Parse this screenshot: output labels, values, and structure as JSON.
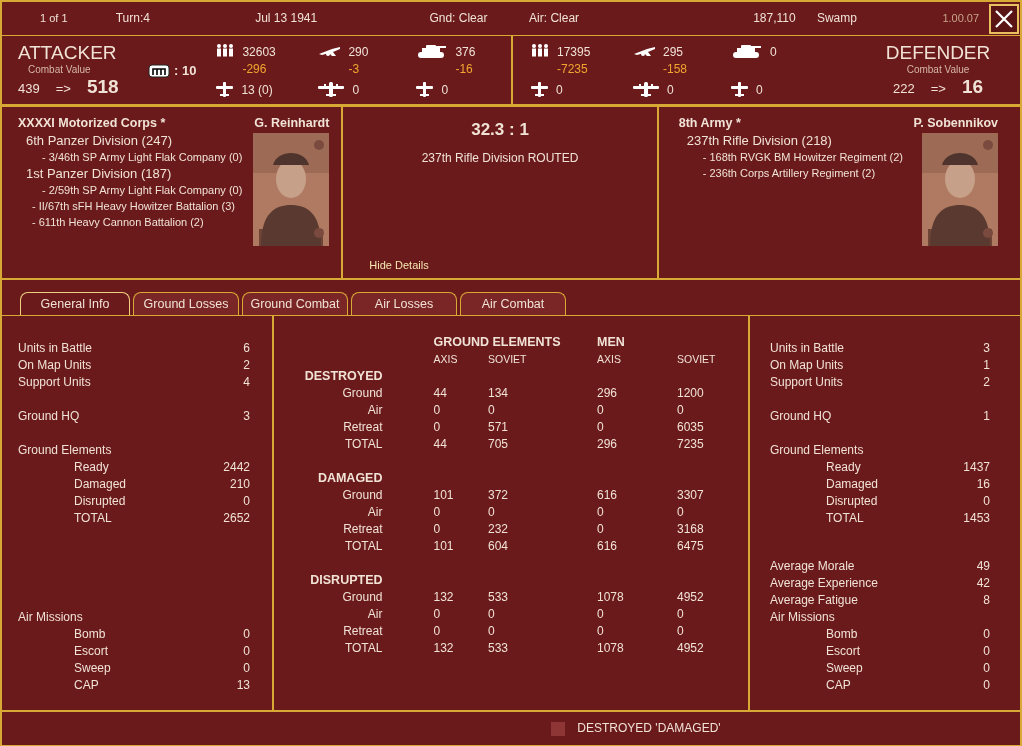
{
  "top_bar": {
    "page": "1 of 1",
    "turn": "Turn:4",
    "date": "Jul 13 1941",
    "ground": "Gnd: Clear",
    "air": "Air: Clear",
    "location": "187,110",
    "terrain": "Swamp",
    "version": "1.00.07"
  },
  "attacker": {
    "title": "ATTACKER",
    "cv_label": "Combat Value",
    "cv_from": "439",
    "arrow": "=>",
    "cv_to": "518",
    "fort": ": 10",
    "stats": [
      {
        "kind": "men",
        "value": "32603",
        "delta": "-296"
      },
      {
        "kind": "gun",
        "value": "290",
        "delta": "-3"
      },
      {
        "kind": "tank",
        "value": "376",
        "delta": "-16"
      },
      {
        "kind": "fighter",
        "value": "13 (0)"
      },
      {
        "kind": "bomber",
        "value": "0"
      },
      {
        "kind": "fighter",
        "value": "0"
      }
    ]
  },
  "defender": {
    "title": "DEFENDER",
    "cv_label": "Combat Value",
    "cv_from": "222",
    "arrow": "=>",
    "cv_to": "16",
    "stats": [
      {
        "kind": "men",
        "value": "17395",
        "delta": "-7235"
      },
      {
        "kind": "gun",
        "value": "295",
        "delta": "-158"
      },
      {
        "kind": "tank",
        "value": "0"
      },
      {
        "kind": "fighter",
        "value": "0"
      },
      {
        "kind": "bomber",
        "value": "0"
      },
      {
        "kind": "fighter",
        "value": "0"
      }
    ]
  },
  "attacker_detail": {
    "hq": "XXXXI Motorized Corps *",
    "leader": "G. Reinhardt",
    "units": [
      {
        "kind": "division",
        "label": "6th Panzer Division (247)",
        "children": [
          {
            "label": "- 3/46th SP Army Light Flak Company (0)"
          }
        ]
      },
      {
        "kind": "division",
        "label": "1st Panzer Division (187)",
        "children": [
          {
            "label": "- 2/59th SP Army Light Flak Company (0)"
          }
        ]
      },
      {
        "kind": "support",
        "label": "- II/67th sFH Heavy Howitzer Battalion (3)"
      },
      {
        "kind": "support",
        "label": "- 611th Heavy Cannon Battalion (2)"
      }
    ]
  },
  "result": {
    "odds": "32.3 : 1",
    "outcome": "237th Rifle Division ROUTED",
    "hide_link": "Hide Details"
  },
  "defender_detail": {
    "hq": "8th Army *",
    "leader": "P. Sobennikov",
    "units": [
      {
        "kind": "division",
        "label": "237th Rifle Division (218)",
        "children": [
          {
            "label": "- 168th RVGK BM Howitzer Regiment (2)"
          },
          {
            "label": "- 236th Corps Artillery Regiment (2)"
          }
        ]
      }
    ]
  },
  "tabs": [
    {
      "label": "General Info",
      "selected": true
    },
    {
      "label": "Ground Losses",
      "selected": false
    },
    {
      "label": "Ground Combat",
      "selected": false
    },
    {
      "label": "Air Losses",
      "selected": false
    },
    {
      "label": "Air Combat",
      "selected": false
    }
  ],
  "attacker_info": [
    [
      {
        "kind": "item",
        "label": "Units in Battle",
        "value": "6"
      },
      {
        "kind": "item",
        "label": "On Map Units",
        "value": "2"
      },
      {
        "kind": "item",
        "label": "Support Units",
        "value": "4"
      }
    ],
    [
      {
        "kind": "item",
        "label": "Ground HQ",
        "value": "3"
      }
    ],
    [
      {
        "kind": "heading",
        "label": "Ground Elements"
      },
      {
        "kind": "sub",
        "label": "Ready",
        "value": "2442"
      },
      {
        "kind": "sub",
        "label": "Damaged",
        "value": "210"
      },
      {
        "kind": "sub",
        "label": "Disrupted",
        "value": "0"
      },
      {
        "kind": "sub",
        "label": "TOTAL",
        "value": "2652"
      }
    ],
    [
      {
        "kind": "heading",
        "label": "Air Missions"
      },
      {
        "kind": "sub",
        "label": "Bomb",
        "value": "0"
      },
      {
        "kind": "sub",
        "label": "Escort",
        "value": "0"
      },
      {
        "kind": "sub",
        "label": "Sweep",
        "value": "0"
      },
      {
        "kind": "sub",
        "label": "CAP",
        "value": "13"
      }
    ]
  ],
  "losses": {
    "groups": [
      "GROUND ELEMENTS",
      "MEN"
    ],
    "columns": [
      "AXIS",
      "SOVIET",
      "AXIS",
      "SOVIET"
    ],
    "sections": [
      {
        "title": "DESTROYED",
        "rows": [
          {
            "label": "Ground",
            "values": [
              "44",
              "134",
              "296",
              "1200"
            ]
          },
          {
            "label": "Air",
            "values": [
              "0",
              "0",
              "0",
              "0"
            ]
          },
          {
            "label": "Retreat",
            "values": [
              "0",
              "571",
              "0",
              "6035"
            ]
          },
          {
            "label": "TOTAL",
            "values": [
              "44",
              "705",
              "296",
              "7235"
            ]
          }
        ]
      },
      {
        "title": "DAMAGED",
        "rows": [
          {
            "label": "Ground",
            "values": [
              "101",
              "372",
              "616",
              "3307"
            ]
          },
          {
            "label": "Air",
            "values": [
              "0",
              "0",
              "0",
              "0"
            ]
          },
          {
            "label": "Retreat",
            "values": [
              "0",
              "232",
              "0",
              "3168"
            ]
          },
          {
            "label": "TOTAL",
            "values": [
              "101",
              "604",
              "616",
              "6475"
            ]
          }
        ]
      },
      {
        "title": "DISRUPTED",
        "rows": [
          {
            "label": "Ground",
            "values": [
              "132",
              "533",
              "1078",
              "4952"
            ]
          },
          {
            "label": "Air",
            "values": [
              "0",
              "0",
              "0",
              "0"
            ]
          },
          {
            "label": "Retreat",
            "values": [
              "0",
              "0",
              "0",
              "0"
            ]
          },
          {
            "label": "TOTAL",
            "values": [
              "132",
              "533",
              "1078",
              "4952"
            ]
          }
        ]
      }
    ]
  },
  "defender_info": [
    [
      {
        "kind": "item",
        "label": "Units in Battle",
        "value": "3"
      },
      {
        "kind": "item",
        "label": "On Map Units",
        "value": "1"
      },
      {
        "kind": "item",
        "label": "Support Units",
        "value": "2"
      }
    ],
    [
      {
        "kind": "item",
        "label": "Ground HQ",
        "value": "1"
      }
    ],
    [
      {
        "kind": "heading",
        "label": "Ground Elements"
      },
      {
        "kind": "sub",
        "label": "Ready",
        "value": "1437"
      },
      {
        "kind": "sub",
        "label": "Damaged",
        "value": "16"
      },
      {
        "kind": "sub",
        "label": "Disrupted",
        "value": "0"
      },
      {
        "kind": "sub",
        "label": "TOTAL",
        "value": "1453"
      }
    ],
    [
      {
        "kind": "item",
        "label": "Average Morale",
        "value": "49"
      },
      {
        "kind": "item",
        "label": "Average Experience",
        "value": "42"
      },
      {
        "kind": "item",
        "label": "Average Fatigue",
        "value": "8"
      },
      {
        "kind": "heading",
        "label": "Air Missions"
      },
      {
        "kind": "sub",
        "label": "Bomb",
        "value": "0"
      },
      {
        "kind": "sub",
        "label": "Escort",
        "value": "0"
      },
      {
        "kind": "sub",
        "label": "Sweep",
        "value": "0"
      },
      {
        "kind": "sub",
        "label": "CAP",
        "value": "0"
      }
    ]
  ],
  "legend": {
    "label": "DESTROYED 'DAMAGED'",
    "color": "#8e3535"
  }
}
